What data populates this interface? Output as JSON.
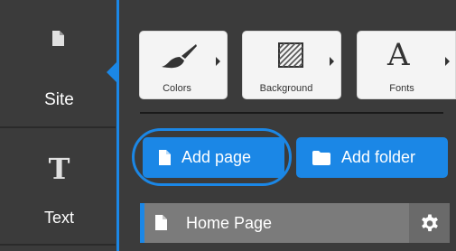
{
  "rail": {
    "items": [
      {
        "label": "Site",
        "icon": "page-icon"
      },
      {
        "label": "Text",
        "icon": "text-T-icon",
        "glyph": "T"
      }
    ]
  },
  "tools": {
    "colors_label": "Colors",
    "background_label": "Background",
    "fonts_label": "Fonts",
    "fonts_glyph": "A"
  },
  "actions": {
    "add_page_label": "Add page",
    "add_folder_label": "Add folder"
  },
  "pages": [
    {
      "label": "Home Page",
      "selected": true
    }
  ],
  "colors": {
    "accent": "#1b87e6",
    "panel": "#3b3b3b",
    "row": "#7b7b7b"
  }
}
